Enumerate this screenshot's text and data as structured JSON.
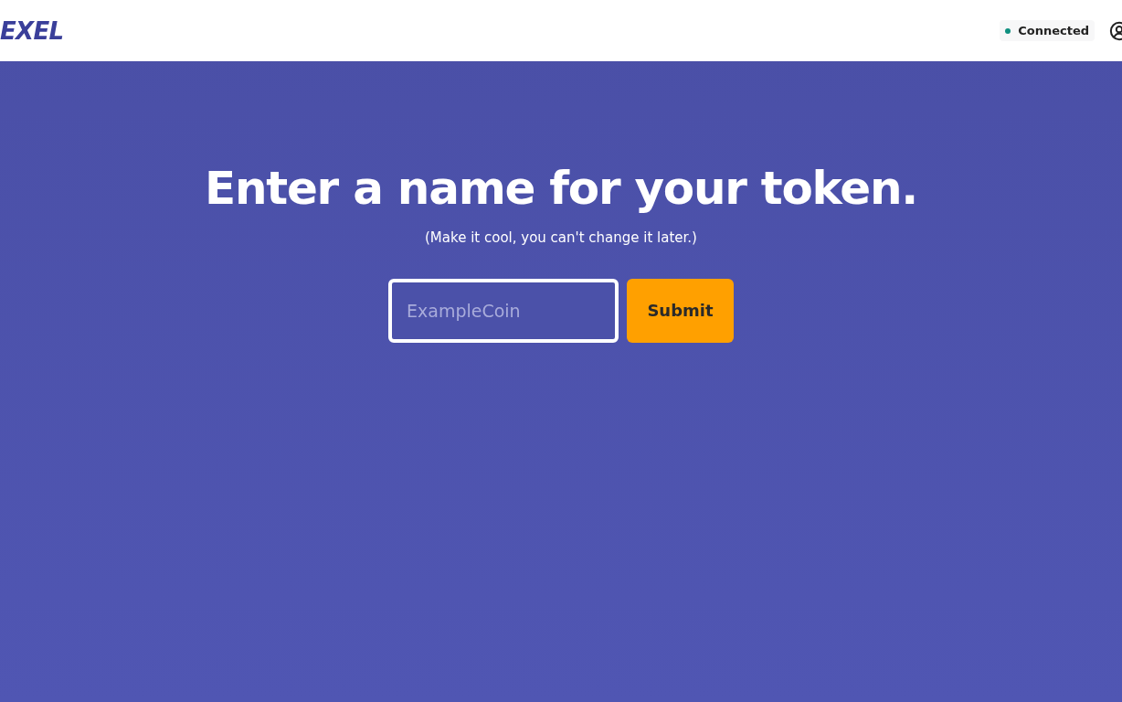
{
  "header": {
    "logo": "EXEL",
    "status": {
      "label": "Connected",
      "color": "#0f8f7f"
    }
  },
  "main": {
    "title": "Enter a name for your token.",
    "subtitle": "(Make it cool, you can't change it later.)",
    "field": {
      "placeholder": "ExampleCoin"
    },
    "button": "Submit"
  }
}
